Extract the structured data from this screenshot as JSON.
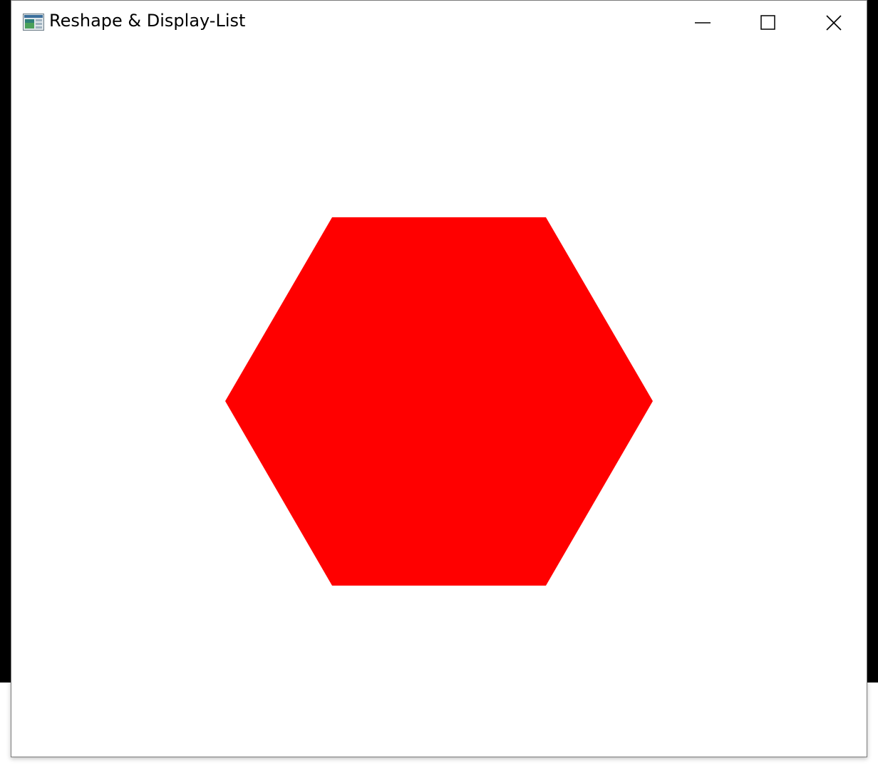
{
  "window": {
    "title": "Reshape & Display-List",
    "controls": {
      "minimize_icon": "minimize-icon",
      "maximize_icon": "maximize-icon",
      "close_icon": "close-icon"
    }
  },
  "canvas": {
    "background": "#ffffff",
    "shape": {
      "type": "hexagon",
      "fill": "#ff0000"
    }
  },
  "desktop": {
    "background": "#000000"
  }
}
